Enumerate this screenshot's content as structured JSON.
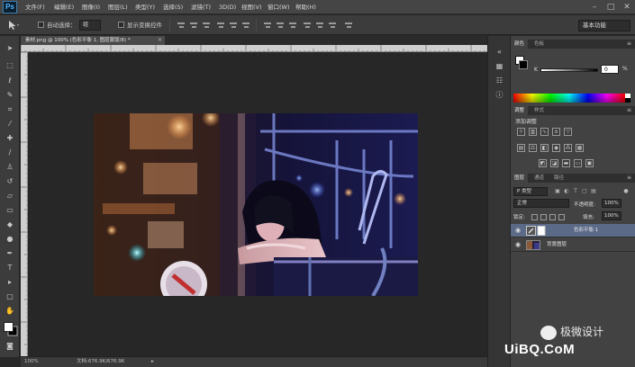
{
  "app": {
    "logo": "Ps",
    "menus": [
      "文件(F)",
      "编辑(E)",
      "图像(I)",
      "图层(L)",
      "类型(Y)",
      "选择(S)",
      "滤镜(T)",
      "3D(D)",
      "视图(V)",
      "窗口(W)",
      "帮助(H)"
    ],
    "window_controls": [
      "–",
      "□",
      "✕"
    ]
  },
  "options_bar": {
    "auto_select_label": "自动选择：",
    "auto_select_value": "组",
    "show_transform_label": "显示变换控件",
    "workspace": "基本功能"
  },
  "document": {
    "tab_title": "素材.png @ 100% (色彩平衡 1, 图层蒙版/8) *",
    "tab_close": "×",
    "zoom": "100%",
    "doc_info": "文档:676.9K/676.9K",
    "status_arrow": "▸"
  },
  "panels": {
    "color_tabs": [
      "颜色",
      "色板"
    ],
    "k_label": "K",
    "k_value": "0",
    "k_unit": "%",
    "adjustments_tabs": [
      "调整",
      "样式"
    ],
    "adjustments_title": "添加调整",
    "layers_tabs": [
      "图层",
      "通道",
      "路径"
    ],
    "kind_filter": "P 类型",
    "blend_mode": "正常",
    "opacity_label": "不透明度:",
    "opacity_value": "100%",
    "lock_label": "锁定:",
    "fill_label": "填充:",
    "fill_value": "100%",
    "layers": [
      {
        "name": "色彩平衡 1",
        "selected": true
      },
      {
        "name": "背景图层",
        "selected": false
      }
    ]
  },
  "watermark": {
    "cn": "极微设计",
    "logo": "UiBQ.CoM"
  },
  "icons": {
    "eye": "eye-icon",
    "menu": "panel-menu-icon"
  }
}
